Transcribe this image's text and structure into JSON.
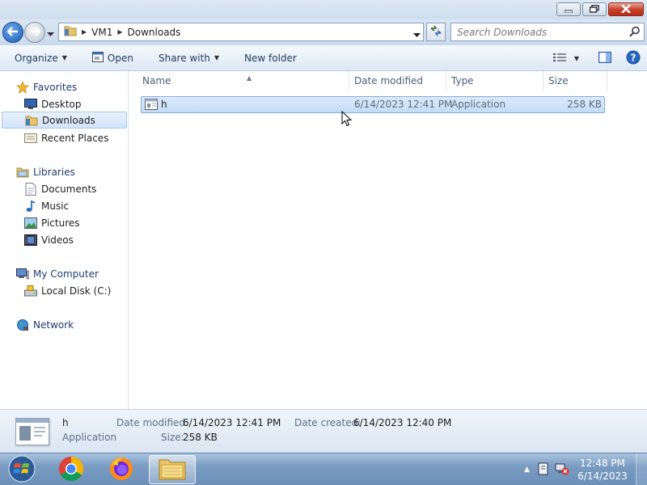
{
  "window": {
    "caption_buttons": [
      "minimize-icon",
      "restore-icon",
      "close-icon"
    ]
  },
  "address": {
    "crumbs": [
      "VM1",
      "Downloads"
    ],
    "search_placeholder": "Search Downloads"
  },
  "toolbar": {
    "organize": "Organize",
    "open": "Open",
    "share_with": "Share with",
    "new_folder": "New folder"
  },
  "nav": {
    "favorites": "Favorites",
    "desktop": "Desktop",
    "downloads": "Downloads",
    "recent_places": "Recent Places",
    "libraries": "Libraries",
    "documents": "Documents",
    "music": "Music",
    "pictures": "Pictures",
    "videos": "Videos",
    "my_computer": "My Computer",
    "local_disk": "Local Disk (C:)",
    "network": "Network"
  },
  "columns": {
    "name": "Name",
    "date_modified": "Date modified",
    "type": "Type",
    "size": "Size"
  },
  "files": [
    {
      "name": "h",
      "date_modified": "6/14/2023 12:41 PM",
      "type": "Application",
      "size": "258 KB"
    }
  ],
  "details": {
    "name": "h",
    "type": "Application",
    "date_modified_label": "Date modified:",
    "date_modified": "6/14/2023 12:41 PM",
    "date_created_label": "Date created:",
    "date_created": "6/14/2023 12:40 PM",
    "size_label": "Size:",
    "size": "258 KB"
  },
  "taskbar": {
    "apps": [
      "start-orb",
      "chrome-icon",
      "firefox-icon",
      "explorer-icon"
    ],
    "time": "12:48 PM",
    "date": "6/14/2023"
  },
  "colors": {
    "selection": "#cce3f9",
    "accent": "#1d5fb8"
  }
}
